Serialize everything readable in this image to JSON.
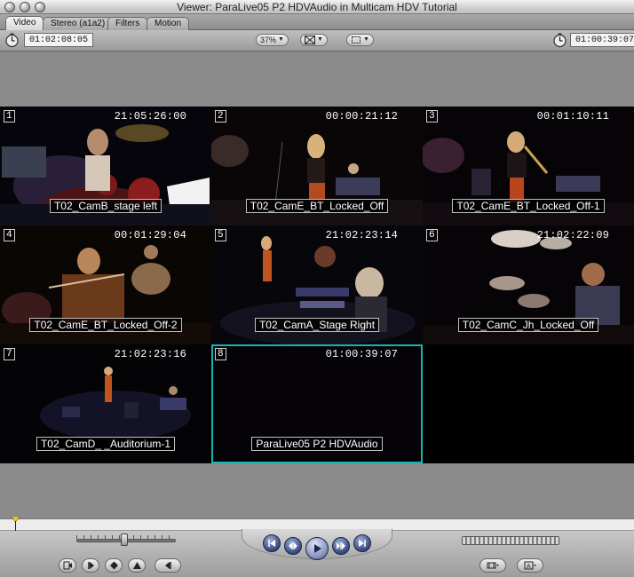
{
  "window": {
    "title": "Viewer: ParaLive05 P2 HDVAudio in Multicam HDV Tutorial"
  },
  "tabs": [
    {
      "label": "Video",
      "active": true
    },
    {
      "label": "Stereo (a1a2)",
      "active": false
    },
    {
      "label": "Filters",
      "active": false
    },
    {
      "label": "Motion",
      "active": false
    }
  ],
  "controls": {
    "duration": "01:02:08:05",
    "zoom": "37%",
    "view_icon": "overlay-icon",
    "fit_icon": "frame-icon",
    "current_timecode": "01:00:39:07"
  },
  "multiclip": {
    "active_angle": 8,
    "angles": [
      {
        "number": "1",
        "timecode": "21:05:26:00",
        "clip": "T02_CamB_stage left"
      },
      {
        "number": "2",
        "timecode": "00:00:21:12",
        "clip": "T02_CamE_BT_Locked_Off"
      },
      {
        "number": "3",
        "timecode": "00:01:10:11",
        "clip": "T02_CamE_BT_Locked_Off-1"
      },
      {
        "number": "4",
        "timecode": "00:01:29:04",
        "clip": "T02_CamE_BT_Locked_Off-2"
      },
      {
        "number": "5",
        "timecode": "21:02:23:14",
        "clip": "T02_CamA_Stage Right"
      },
      {
        "number": "6",
        "timecode": "21:02:22:09",
        "clip": "T02_CamC_Jh_Locked_Off"
      },
      {
        "number": "7",
        "timecode": "21:02:23:16",
        "clip": "T02_CamD_ _Auditorium-1"
      },
      {
        "number": "8",
        "timecode": "01:00:39:07",
        "clip": "ParaLive05 P2 HDVAudio"
      }
    ]
  },
  "transport": {
    "buttons": [
      "go-to-in-point",
      "play-previous-edit",
      "play",
      "play-next-edit",
      "go-to-out-point"
    ],
    "bottom_buttons": [
      "match-frame",
      "mark-in",
      "add-marker",
      "mark-clip",
      "mark-out"
    ],
    "playhead_position": 0.024
  },
  "colors": {
    "active_angle_outline": "#17b3b0",
    "transport_blue": "#3e4f86"
  }
}
